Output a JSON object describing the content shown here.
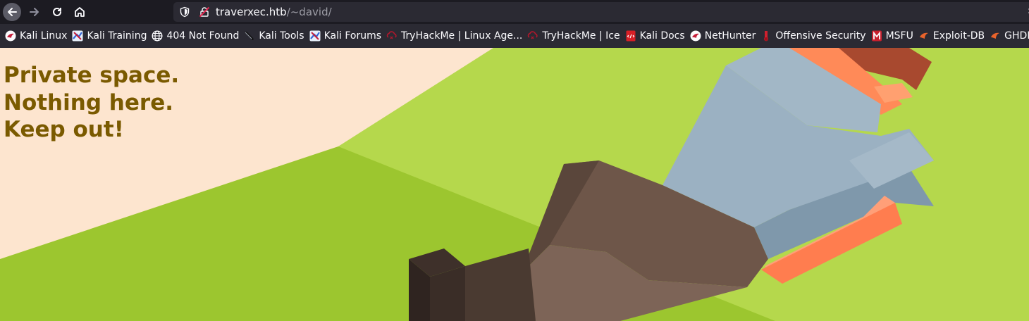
{
  "browser": {
    "url_host": "traverxec.htb",
    "url_path": "/~david/"
  },
  "bookmarks": [
    {
      "label": "Kali Linux",
      "icon": "kali-dragon-icon"
    },
    {
      "label": "Kali Training",
      "icon": "kali-training-icon"
    },
    {
      "label": "404 Not Found",
      "icon": "globe-icon"
    },
    {
      "label": "Kali Tools",
      "icon": "kali-tools-icon"
    },
    {
      "label": "Kali Forums",
      "icon": "kali-forums-icon"
    },
    {
      "label": "TryHackMe | Linux Age...",
      "icon": "tryhackme-icon"
    },
    {
      "label": "TryHackMe | Ice",
      "icon": "tryhackme-icon"
    },
    {
      "label": "Kali Docs",
      "icon": "kali-docs-icon"
    },
    {
      "label": "NetHunter",
      "icon": "kali-dragon-icon"
    },
    {
      "label": "Offensive Security",
      "icon": "offsec-icon"
    },
    {
      "label": "MSFU",
      "icon": "msfu-icon"
    },
    {
      "label": "Exploit-DB",
      "icon": "exploit-db-icon"
    },
    {
      "label": "GHDB",
      "icon": "exploit-db-icon"
    }
  ],
  "page": {
    "lines": [
      "Private space.",
      "Nothing here.",
      "Keep out!"
    ],
    "text_color": "#7a5a00",
    "background_colors": {
      "cream": "#fde5cf",
      "grass_light": "#b4d64a",
      "grass_dark": "#9ac52e"
    }
  }
}
